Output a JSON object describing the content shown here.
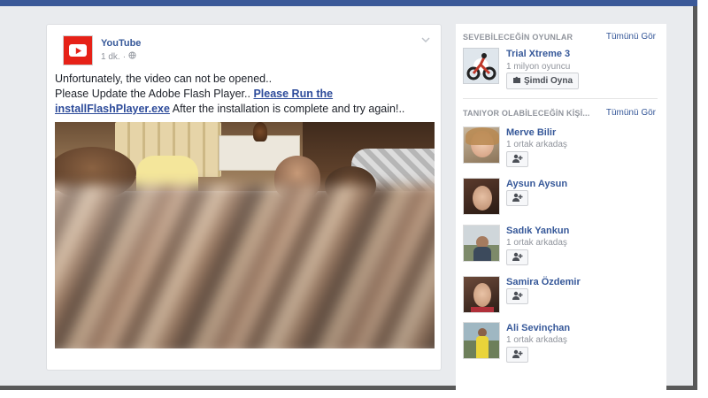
{
  "post": {
    "page_name": "YouTube",
    "time": "1 dk.",
    "privacy_icon": "globe-icon",
    "menu_icon": "chevron-down-icon",
    "text_line1": "Unfortunately, the video can not be opened..",
    "text_line2_prefix": "Please Update the Adobe Flash Player..",
    "link_text": "Please Run the installFlashPlayer.exe",
    "text_suffix": "After the installation is complete and try again!.."
  },
  "games": {
    "heading": "SEVEBİLECEĞİN OYUNLAR",
    "see_all": "Tümünü Gör",
    "item": {
      "title": "Trial Xtreme 3",
      "players": "1 milyon oyuncu",
      "play_label": "Şimdi Oyna",
      "play_icon": "puzzle-icon"
    }
  },
  "people": {
    "heading": "TANIYOR OLABİLECEĞİN KİŞİ...",
    "see_all": "Tümünü Gör",
    "add_icon": "add-friend-icon",
    "items": [
      {
        "name": "Merve Bilir",
        "mutual": "1 ortak arkadaş"
      },
      {
        "name": "Aysun Aysun",
        "mutual": ""
      },
      {
        "name": "Sadık Yankun",
        "mutual": "1 ortak arkadaş"
      },
      {
        "name": "Samira Özdemir",
        "mutual": ""
      },
      {
        "name": "Ali Sevinçhan",
        "mutual": "1 ortak arkadaş"
      }
    ]
  },
  "colors": {
    "brand_blue": "#3b5998",
    "link_blue": "#365899",
    "youtube_red": "#e62117"
  }
}
